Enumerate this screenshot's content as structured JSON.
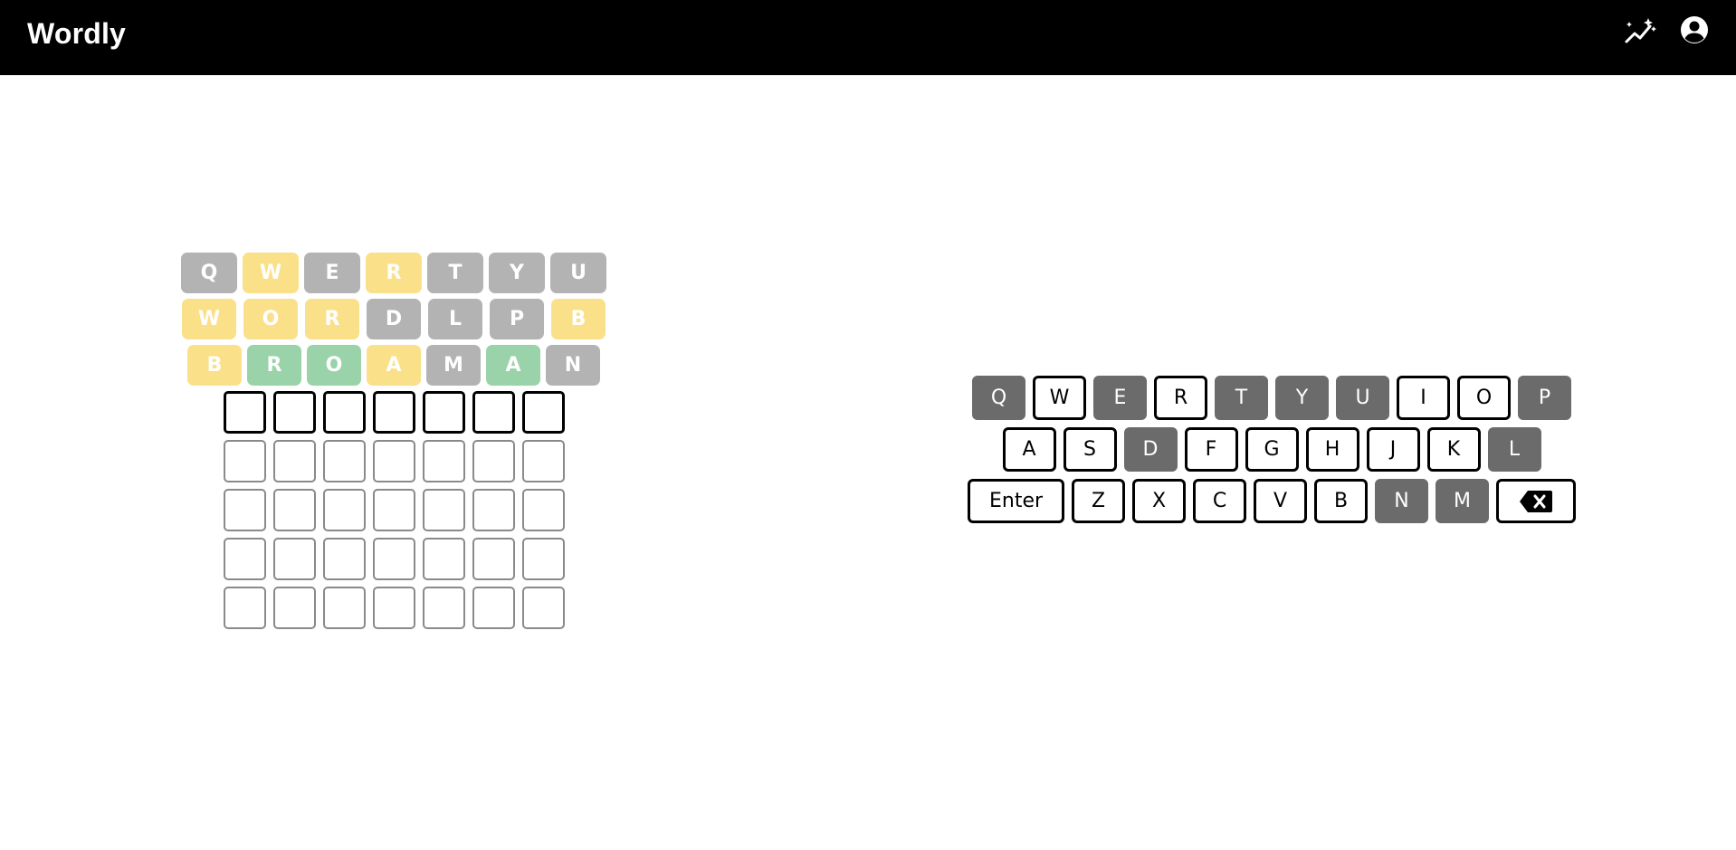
{
  "app": {
    "title": "Wordly"
  },
  "header": {
    "stats_icon": "stats-chart-icon",
    "account_icon": "account-circle-icon"
  },
  "board": {
    "guesses": [
      {
        "letters": [
          "Q",
          "W",
          "E",
          "R",
          "T",
          "Y",
          "U"
        ],
        "states": [
          "absent",
          "present",
          "absent",
          "present",
          "absent",
          "absent",
          "absent"
        ]
      },
      {
        "letters": [
          "W",
          "O",
          "R",
          "D",
          "L",
          "P",
          "B"
        ],
        "states": [
          "present",
          "present",
          "present",
          "absent",
          "absent",
          "absent",
          "present"
        ]
      },
      {
        "letters": [
          "B",
          "R",
          "O",
          "A",
          "M",
          "A",
          "N"
        ],
        "states": [
          "present",
          "correct",
          "correct",
          "present",
          "absent",
          "correct",
          "absent"
        ]
      }
    ],
    "empty_rows": 5,
    "columns": 7
  },
  "keyboard": {
    "rows": [
      [
        {
          "label": "Q",
          "used": true
        },
        {
          "label": "W",
          "used": false
        },
        {
          "label": "E",
          "used": true
        },
        {
          "label": "R",
          "used": false
        },
        {
          "label": "T",
          "used": true
        },
        {
          "label": "Y",
          "used": true
        },
        {
          "label": "U",
          "used": true
        },
        {
          "label": "I",
          "used": false
        },
        {
          "label": "O",
          "used": false
        },
        {
          "label": "P",
          "used": true
        }
      ],
      [
        {
          "label": "A",
          "used": false
        },
        {
          "label": "S",
          "used": false
        },
        {
          "label": "D",
          "used": true
        },
        {
          "label": "F",
          "used": false
        },
        {
          "label": "G",
          "used": false
        },
        {
          "label": "H",
          "used": false
        },
        {
          "label": "J",
          "used": false
        },
        {
          "label": "K",
          "used": false
        },
        {
          "label": "L",
          "used": true
        }
      ],
      [
        {
          "label": "Enter",
          "used": false,
          "wide": true
        },
        {
          "label": "Z",
          "used": false
        },
        {
          "label": "X",
          "used": false
        },
        {
          "label": "C",
          "used": false
        },
        {
          "label": "V",
          "used": false
        },
        {
          "label": "B",
          "used": false
        },
        {
          "label": "N",
          "used": true
        },
        {
          "label": "M",
          "used": true
        }
      ]
    ],
    "backspace_icon": "backspace-icon"
  },
  "colors": {
    "absent": "#b3b3b3",
    "present": "#fbe08a",
    "correct": "#9ad3a9",
    "used_key": "#6b6b6b",
    "header_bg": "#000000"
  }
}
